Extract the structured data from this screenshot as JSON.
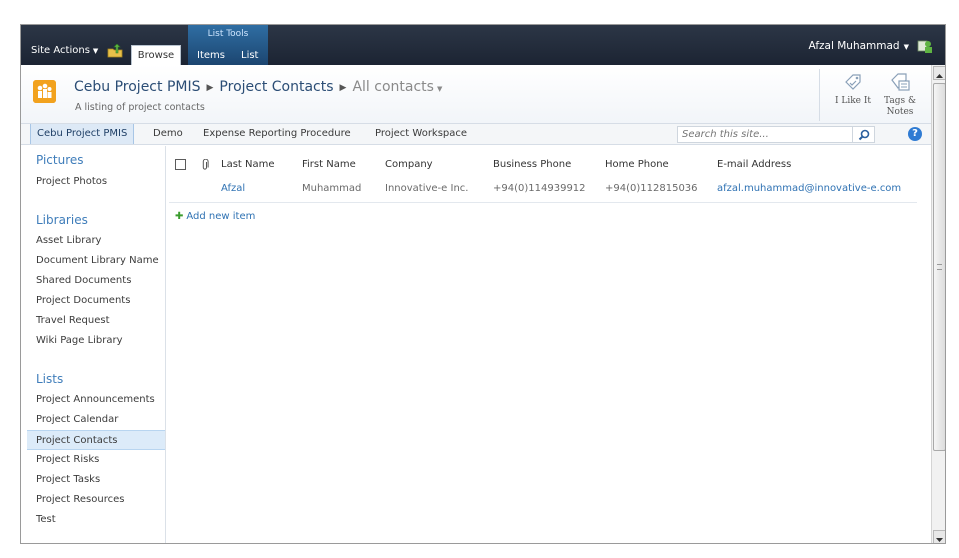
{
  "ribbon": {
    "site_actions": "Site Actions",
    "browse_tab": "Browse",
    "list_tools": "List Tools",
    "items_tab": "Items",
    "list_tab": "List",
    "user": "Afzal Muhammad"
  },
  "title_area": {
    "site": "Cebu Project PMIS",
    "list": "Project Contacts",
    "view": "All contacts",
    "description": "A listing of project contacts",
    "like_it": "I Like It",
    "tags_notes_line1": "Tags &",
    "tags_notes_line2": "Notes"
  },
  "top_nav": {
    "items": [
      "Cebu Project PMIS",
      "Demo",
      "Expense Reporting Procedure",
      "Project Workspace"
    ],
    "search_placeholder": "Search this site..."
  },
  "quick_launch": {
    "pictures_heading": "Pictures",
    "pictures": [
      "Project Photos"
    ],
    "libraries_heading": "Libraries",
    "libraries": [
      "Asset Library",
      "Document Library Name",
      "Shared Documents",
      "Project Documents",
      "Travel Request",
      "Wiki Page Library"
    ],
    "lists_heading": "Lists",
    "lists": [
      "Project Announcements",
      "Project Calendar",
      "Project Contacts",
      "Project Risks",
      "Project Tasks",
      "Project Resources",
      "Test"
    ]
  },
  "list": {
    "columns": [
      "Last Name",
      "First Name",
      "Company",
      "Business Phone",
      "Home Phone",
      "E-mail Address"
    ],
    "rows": [
      [
        "Afzal",
        "Muhammad",
        "Innovative-e Inc.",
        "+94(0)114939912",
        "+94(0)112815036",
        "afzal.muhammad@innovative-e.com"
      ]
    ],
    "add_new_item": "Add new item"
  },
  "colors": {
    "ribbon_dark": "#1c2433",
    "list_tools": "#2f6ea3",
    "link": "#2f72b3",
    "heading": "#3f7dba",
    "selected": "#dcebf9"
  }
}
